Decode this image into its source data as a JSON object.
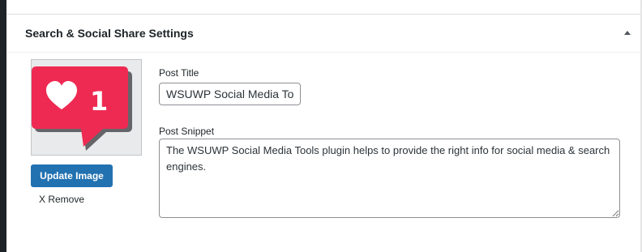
{
  "panel": {
    "title": "Search & Social Share Settings",
    "toggle_icon": "triangle-up-icon"
  },
  "image": {
    "icon": "heart-notification-icon",
    "badge_count": "1",
    "colors": {
      "bubble": "#ee2a52",
      "shadow": "#4d4d52",
      "background": "#e8eaec"
    }
  },
  "actions": {
    "update_label": "Update Image",
    "remove_label": "X Remove"
  },
  "fields": {
    "title_label": "Post Title",
    "title_value": "WSUWP Social Media Too",
    "snippet_label": "Post Snippet",
    "snippet_value": "The WSUWP Social Media Tools plugin helps to provide the right info for social media & search engines."
  },
  "colors": {
    "primary_button": "#2271b1",
    "left_rail": "#1d2327"
  }
}
